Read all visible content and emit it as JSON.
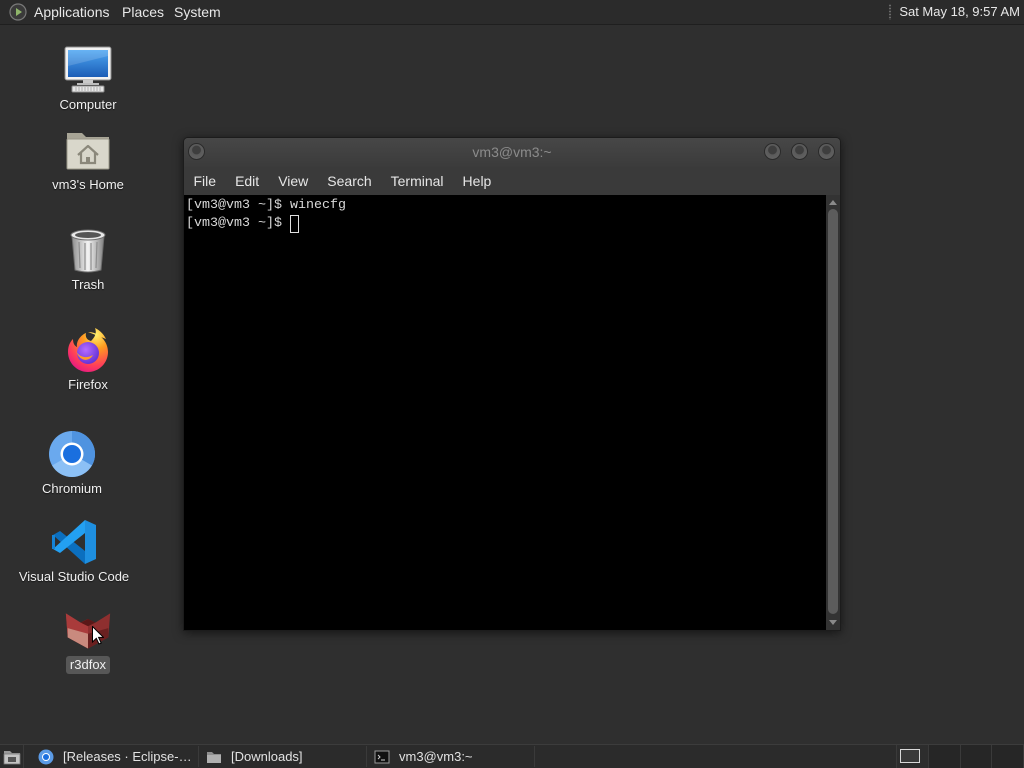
{
  "top_panel": {
    "menus": [
      "Applications",
      "Places",
      "System"
    ],
    "logo_icon": "distro-logo-icon",
    "clock": "Sat May 18, 9:57 AM"
  },
  "desktop_icons": [
    {
      "label": "Computer",
      "icon": "computer-icon"
    },
    {
      "label": "vm3's Home",
      "icon": "home-folder-icon"
    },
    {
      "label": "Trash",
      "icon": "trash-icon"
    },
    {
      "label": "Firefox",
      "icon": "firefox-icon"
    },
    {
      "label": "Chromium",
      "icon": "chromium-icon"
    },
    {
      "label": "Visual Studio Code",
      "icon": "vscode-icon"
    },
    {
      "label": "r3dfox",
      "icon": "r3dfox-icon",
      "selected": true
    }
  ],
  "terminal": {
    "title": "vm3@vm3:~",
    "menu": [
      "File",
      "Edit",
      "View",
      "Search",
      "Terminal",
      "Help"
    ],
    "lines": [
      "[vm3@vm3 ~]$ winecfg",
      "[vm3@vm3 ~]$ "
    ]
  },
  "taskbar": {
    "show_desktop_icon": "show-desktop-icon",
    "tasks": [
      {
        "label": "[Releases · Eclipse-…",
        "icon": "browser-icon"
      },
      {
        "label": "[Downloads]",
        "icon": "folder-icon"
      },
      {
        "label": "vm3@vm3:~",
        "icon": "terminal-icon"
      }
    ]
  },
  "colors": {
    "desktop_bg": "#2f2f2f",
    "panel_bg": "#2b2b2b",
    "terminal_bg": "#000000",
    "terminal_fg": "#d8d8d8",
    "selected_label_bg": "#575757"
  }
}
